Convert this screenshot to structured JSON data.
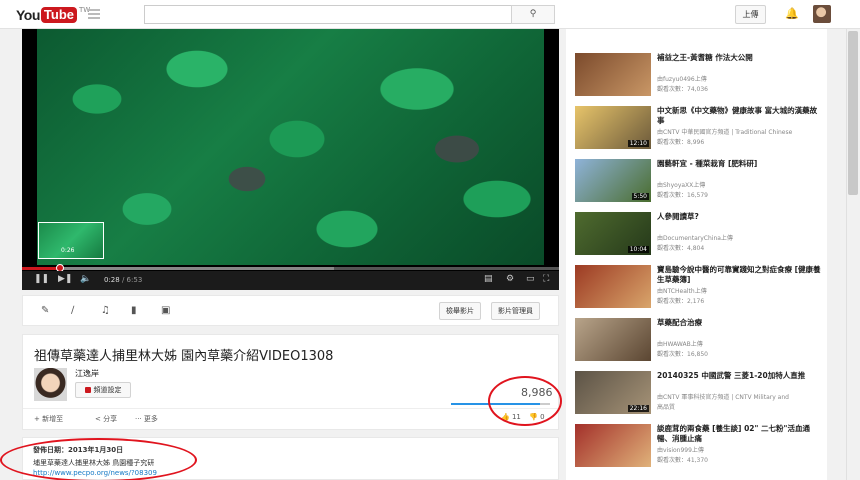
{
  "header": {
    "logo_you": "You",
    "logo_tube": "Tube",
    "logo_region": "TW",
    "search_placeholder": "",
    "upload_label": "上傳"
  },
  "player": {
    "current_time": "0:28",
    "duration": "/ 6:53",
    "preview_time": "0:26",
    "played_fraction": 0.07
  },
  "actions": {
    "report_label": "檢舉影片",
    "save_label": "影片管理員"
  },
  "video": {
    "title": "祖傳草藥達人捕里林大姊 園內草藥介紹VIDEO1308",
    "channel": "江逸岸",
    "subscribe_label": "頻道設定",
    "views": "8,986",
    "tab_add": "新增至",
    "tab_share": "分享",
    "tab_more": "更多",
    "likes": "11",
    "dislikes": "0"
  },
  "description": {
    "published": "發佈日期：2013年1月30日",
    "line1": "埔里草藥達人捕里林大姊 鳥園種子究研",
    "line2": "http://www.pecpo.org/news/?08309"
  },
  "related": [
    {
      "title": "補益之王-黃耆糖 作法大公開",
      "uploader": "由fuzyu0496上傳",
      "views": "觀看次數：74,036",
      "duration": "",
      "colors": [
        "#7b4a2c",
        "#c99766"
      ]
    },
    {
      "title": "中文新思《中文藥物》健康故事 富大城的漢藥故事",
      "uploader": "由CNTV 中華民國官方頻道 | Traditional Chinese",
      "views": "觀看次數：8,996",
      "duration": "12:10",
      "colors": [
        "#e7c46a",
        "#6c5a3b"
      ]
    },
    {
      "title": "園藝軒宜 - 種菜栽育 [肥料研]",
      "uploader": "由ShyoyaXX上傳",
      "views": "觀看次數：16,579",
      "duration": "5:50",
      "colors": [
        "#8fb3d9",
        "#4a6d2e"
      ]
    },
    {
      "title": "人參閱讀草?",
      "uploader": "由DocumentaryChina上傳",
      "views": "觀看次數：4,804",
      "duration": "10:04",
      "colors": [
        "#4f6b2f",
        "#25391a"
      ]
    },
    {
      "title": "寶島驗今說中醫的可靠實踐知之對症食療 [健康養生草藥簿]",
      "uploader": "由NTCHealth上傳",
      "views": "觀看次數：2,176",
      "duration": "",
      "colors": [
        "#9c3a23",
        "#d9a56b"
      ]
    },
    {
      "title": "草藥配合治療",
      "uploader": "由HWAWAB上傳",
      "views": "觀看次數：16,850",
      "duration": "",
      "colors": [
        "#b8a48a",
        "#5b4632"
      ]
    },
    {
      "title": "20140325 中國武警 三菱1-20加特人直推",
      "uploader": "由CNTV 軍事科技官方頻道 | CNTV Military and",
      "views": "高品質",
      "duration": "22:16",
      "colors": [
        "#5c5346",
        "#a69377"
      ]
    },
    {
      "title": "談鹿茸的兩食藥 [養生談] 02\" 二七粉\"活血通暢、消腫止痛",
      "uploader": "由vision999上傳",
      "views": "觀看次數：41,370",
      "duration": "",
      "colors": [
        "#a3302a",
        "#e0b27a"
      ]
    }
  ]
}
